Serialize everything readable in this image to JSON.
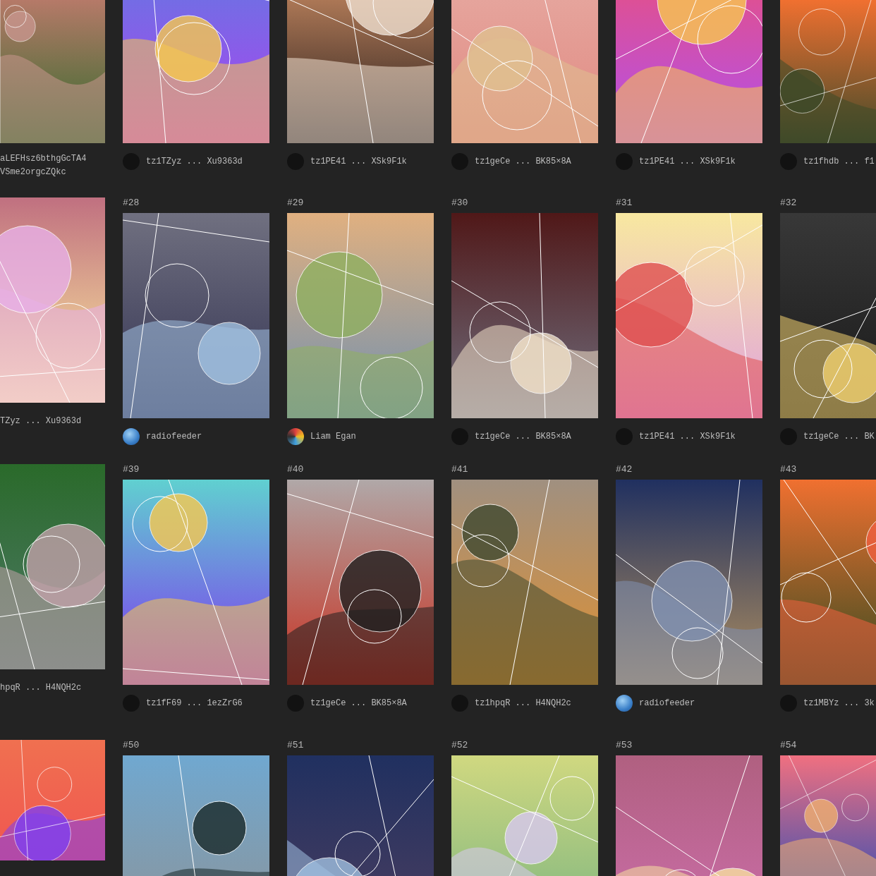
{
  "rows": [
    {
      "cards": [
        {
          "owner": {
            "name": "aLEFHsz6bthgGcTA4VSme2orgcZQkc",
            "kind": "bare"
          }
        },
        {
          "owner": {
            "name": "tz1TZyz ... Xu9363d",
            "kind": "blank"
          }
        },
        {
          "owner": {
            "name": "tz1PE41 ... XSk9F1k",
            "kind": "blank"
          }
        },
        {
          "owner": {
            "name": "tz1geCe ... BK85×8A",
            "kind": "blank"
          }
        },
        {
          "owner": {
            "name": "tz1PE41 ... XSk9F1k",
            "kind": "blank"
          }
        },
        {
          "owner": {
            "name": "tz1fhdb ... f1",
            "kind": "blank"
          }
        }
      ]
    },
    {
      "cards": [
        {
          "owner": {
            "name": "TZyz ... Xu9363d",
            "kind": "bare"
          }
        },
        {
          "number": "#28",
          "owner": {
            "name": "radiofeeder",
            "kind": "icon"
          }
        },
        {
          "number": "#29",
          "owner": {
            "name": "Liam Egan",
            "kind": "photo"
          }
        },
        {
          "number": "#30",
          "owner": {
            "name": "tz1geCe ... BK85×8A",
            "kind": "blank"
          }
        },
        {
          "number": "#31",
          "owner": {
            "name": "tz1PE41 ... XSk9F1k",
            "kind": "blank"
          }
        },
        {
          "number": "#32",
          "owner": {
            "name": "tz1geCe ... BK",
            "kind": "blank"
          }
        }
      ]
    },
    {
      "cards": [
        {
          "owner": {
            "name": "hpqR ... H4NQH2c",
            "kind": "bare"
          }
        },
        {
          "number": "#39",
          "owner": {
            "name": "tz1fF69 ... 1ezZrG6",
            "kind": "blank"
          }
        },
        {
          "number": "#40",
          "owner": {
            "name": "tz1geCe ... BK85×8A",
            "kind": "blank"
          }
        },
        {
          "number": "#41",
          "owner": {
            "name": "tz1hpqR ... H4NQH2c",
            "kind": "blank"
          }
        },
        {
          "number": "#42",
          "owner": {
            "name": "radiofeeder",
            "kind": "icon"
          }
        },
        {
          "number": "#43",
          "owner": {
            "name": "tz1MBYz ... 3k",
            "kind": "blank"
          }
        }
      ]
    },
    {
      "cards": [
        {
          "number": "#50"
        },
        {
          "number": "#51"
        },
        {
          "number": "#52"
        },
        {
          "number": "#53"
        },
        {
          "number": "#54"
        }
      ]
    }
  ]
}
